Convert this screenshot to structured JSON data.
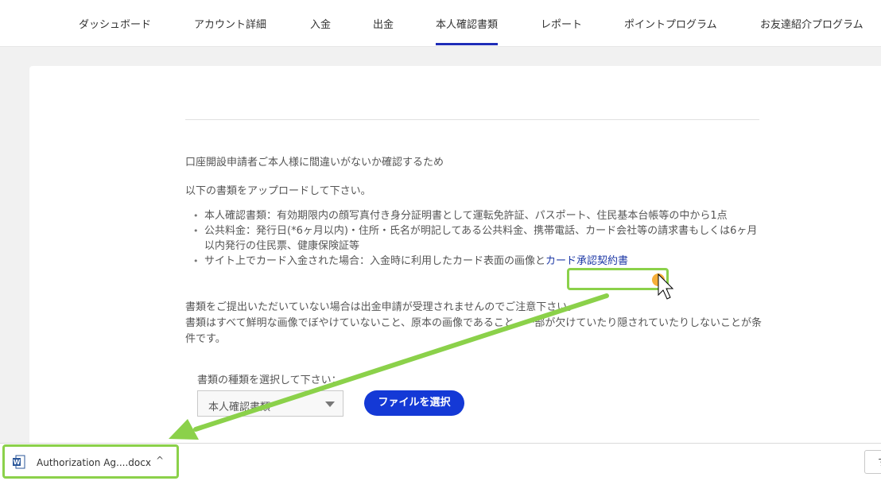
{
  "nav": {
    "items": [
      {
        "label": "ダッシュボード"
      },
      {
        "label": "アカウント詳細"
      },
      {
        "label": "入金"
      },
      {
        "label": "出金"
      },
      {
        "label": "本人確認書類"
      },
      {
        "label": "レポート"
      },
      {
        "label": "ポイントプログラム"
      },
      {
        "label": "お友達紹介プログラム"
      }
    ],
    "active": "本人確認書類"
  },
  "content": {
    "intro_line1": "口座開設申請者ご本人様に間違いがないか確認するため",
    "intro_line2": "以下の書類をアップロードして下さい。",
    "bullet1": "本人確認書類：有効期限内の顔写真付き身分証明書として運転免許証、パスポート、住民基本台帳等の中から1点",
    "bullet2": "公共料金：発行日(*6ヶ月以内)・住所・氏名が明記してある公共料金、携帯電話、カード会社等の請求書もしくは6ヶ月以内発行の住民票、健康保険証等",
    "bullet3_text": "サイト上でカード入金された場合：入金時に利用したカード表面の画像と",
    "bullet3_link": "カード承認契約書",
    "notice_line1": "書類をご提出いただいていない場合は出金申請が受理されませんのでご注意下さい。",
    "notice_line2": "書類はすべて鮮明な画像でぼやけていないこと、原本の画像であること、一部が欠けていたり隠されていたりしないことが条件です。"
  },
  "upload": {
    "select_label": "書類の種類を選択して下さい：",
    "select_value": "本人確認書類",
    "file_button": "ファイルを選択"
  },
  "download_bar": {
    "file_name": "Authorization Ag....docx",
    "file_icon": "word-doc-icon",
    "chevron": "^",
    "show_all_label": "す"
  },
  "colors": {
    "accent": "#1439d6",
    "nav_underline": "#1f2db8",
    "link": "#1f3aa6",
    "annotation": "#8bd14a"
  }
}
